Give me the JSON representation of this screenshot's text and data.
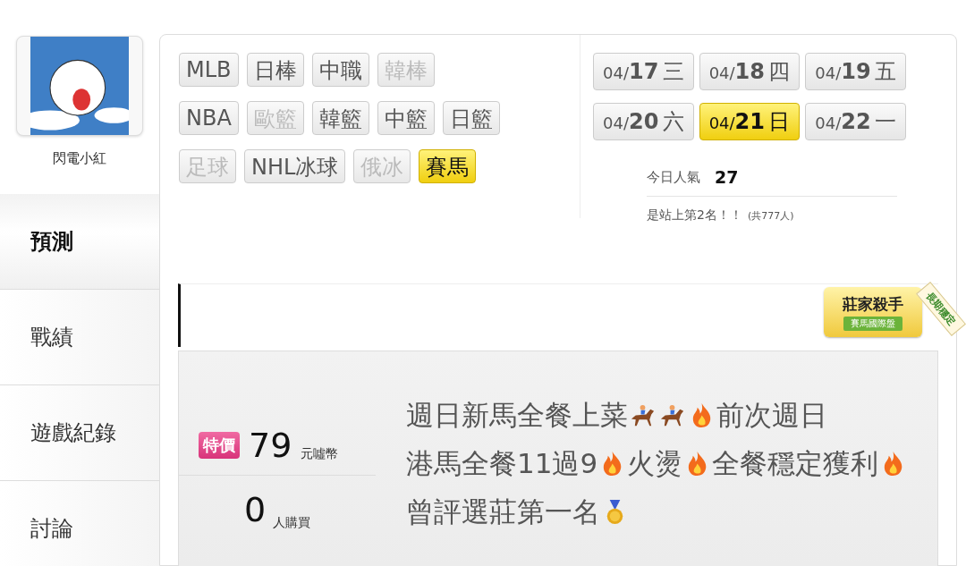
{
  "user": {
    "name": "閃電小紅"
  },
  "nav": [
    {
      "label": "預測",
      "selected": true
    },
    {
      "label": "戰績",
      "selected": false
    },
    {
      "label": "遊戲紀錄",
      "selected": false
    },
    {
      "label": "討論",
      "selected": false
    }
  ],
  "sports": [
    [
      {
        "label": "MLB",
        "disabled": false,
        "selected": false
      },
      {
        "label": "日棒",
        "disabled": false,
        "selected": false
      },
      {
        "label": "中職",
        "disabled": false,
        "selected": false
      },
      {
        "label": "韓棒",
        "disabled": true,
        "selected": false
      }
    ],
    [
      {
        "label": "NBA",
        "disabled": false,
        "selected": false
      },
      {
        "label": "歐籃",
        "disabled": true,
        "selected": false
      },
      {
        "label": "韓籃",
        "disabled": false,
        "selected": false
      },
      {
        "label": "中籃",
        "disabled": false,
        "selected": false
      },
      {
        "label": "日籃",
        "disabled": false,
        "selected": false
      }
    ],
    [
      {
        "label": "足球",
        "disabled": true,
        "selected": false
      },
      {
        "label": "NHL冰球",
        "disabled": false,
        "selected": false
      },
      {
        "label": "俄冰",
        "disabled": true,
        "selected": false
      },
      {
        "label": "賽馬",
        "disabled": false,
        "selected": true
      }
    ]
  ],
  "dates": [
    {
      "month": "04/",
      "day": "17",
      "weekday": "三",
      "selected": false
    },
    {
      "month": "04/",
      "day": "18",
      "weekday": "四",
      "selected": false
    },
    {
      "month": "04/",
      "day": "19",
      "weekday": "五",
      "selected": false
    },
    {
      "month": "04/",
      "day": "20",
      "weekday": "六",
      "selected": false
    },
    {
      "month": "04/",
      "day": "21",
      "weekday": "日",
      "selected": true
    },
    {
      "month": "04/",
      "day": "22",
      "weekday": "一",
      "selected": false
    }
  ],
  "stats": {
    "popularity_label": "今日人氣",
    "popularity": "27",
    "rank_text": "是站上第2名！！",
    "rank_note": "(共777人)"
  },
  "badge": {
    "title": "莊家殺手",
    "subtitle": "賽馬國際盤",
    "ribbon": "長期穩定"
  },
  "offer": {
    "tag": "特價",
    "price": "79",
    "price_unit": "元噓幣",
    "buyers": "0",
    "buyers_unit": "人購買",
    "description": [
      {
        "kind": "text",
        "text": "週日新馬全餐上菜"
      },
      {
        "kind": "horse"
      },
      {
        "kind": "horse"
      },
      {
        "kind": "fire"
      },
      {
        "kind": "text",
        "text": "前次週日"
      },
      {
        "kind": "text",
        "text": "港馬全餐11過9"
      },
      {
        "kind": "fire"
      },
      {
        "kind": "text",
        "text": "火燙"
      },
      {
        "kind": "fire"
      },
      {
        "kind": "text",
        "text": "全餐穩定獲"
      },
      {
        "kind": "text",
        "text": "利"
      },
      {
        "kind": "fire"
      },
      {
        "kind": "text",
        "text": "曾評選莊第一名"
      },
      {
        "kind": "medal"
      }
    ]
  }
}
